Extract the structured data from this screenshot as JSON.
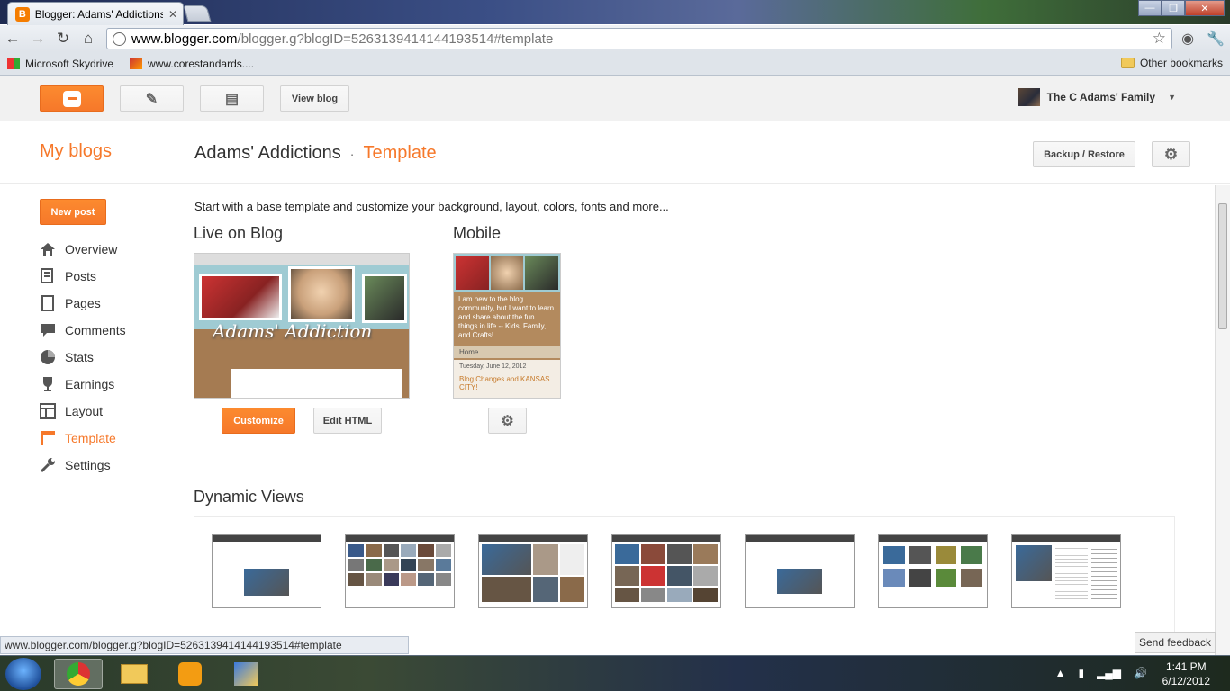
{
  "browser": {
    "tab_title": "Blogger: Adams' Addictions",
    "tab_favicon": "B",
    "url_domain": "www.blogger.com",
    "url_path": "/blogger.g?blogID=5263139414144193514#template",
    "bookmarks": [
      "Microsoft Skydrive",
      "www.corestandards...."
    ],
    "other_bookmarks": "Other bookmarks",
    "status_url": "www.blogger.com/blogger.g?blogID=5263139414144193514#template"
  },
  "header": {
    "view_blog": "View blog",
    "user_name": "The C Adams' Family"
  },
  "title": {
    "my_blogs": "My blogs",
    "blog_name": "Adams' Addictions",
    "separator": "·",
    "current": "Template",
    "backup_restore": "Backup / Restore"
  },
  "sidebar": {
    "new_post": "New post",
    "items": [
      {
        "label": "Overview",
        "icon": "home-icon"
      },
      {
        "label": "Posts",
        "icon": "posts-icon"
      },
      {
        "label": "Pages",
        "icon": "pages-icon"
      },
      {
        "label": "Comments",
        "icon": "comments-icon"
      },
      {
        "label": "Stats",
        "icon": "stats-icon"
      },
      {
        "label": "Earnings",
        "icon": "trophy-icon"
      },
      {
        "label": "Layout",
        "icon": "layout-icon"
      },
      {
        "label": "Template",
        "icon": "template-icon"
      },
      {
        "label": "Settings",
        "icon": "wrench-icon"
      }
    ]
  },
  "main": {
    "intro": "Start with a base template and customize your background, layout, colors, fonts and more...",
    "live_heading": "Live on Blog",
    "mobile_heading": "Mobile",
    "customize": "Customize",
    "edit_html": "Edit HTML",
    "dynamic_heading": "Dynamic Views",
    "mobile_preview": {
      "description": "I am new to the blog community, but I want to learn and share about the fun things in life -- Kids, Family, and Crafts!",
      "home": "Home",
      "date": "Tuesday, June 12, 2012",
      "post_title": "Blog Changes and KANSAS CITY!"
    },
    "live_preview": {
      "blog_title": "Adams' Addiction"
    }
  },
  "feedback": "Send feedback",
  "taskbar": {
    "time": "1:41 PM",
    "date": "6/12/2012"
  },
  "colors": {
    "accent": "#f6782a"
  }
}
